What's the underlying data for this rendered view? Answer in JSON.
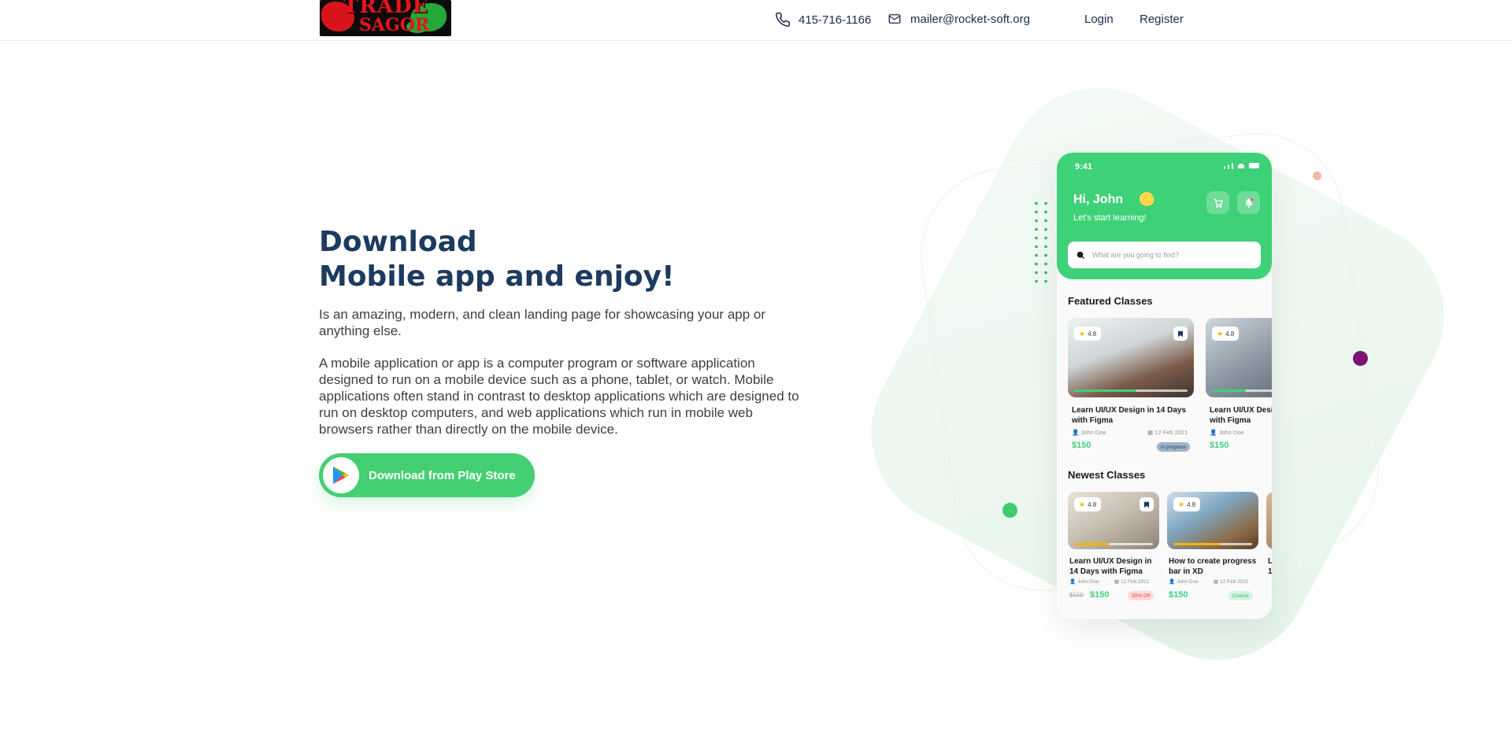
{
  "header": {
    "logo_line1": "TRADE",
    "logo_line2": "SAGOR",
    "phone": "415-716-1166",
    "email": "mailer@rocket-soft.org",
    "login": "Login",
    "register": "Register",
    "icons": {
      "phone": "phone-icon",
      "email": "mail-icon"
    }
  },
  "hero": {
    "title_line1": "Download",
    "title_line2": "Mobile app and enjoy!",
    "lead": "Is an amazing, modern, and clean landing page for showcasing your app or anything else.",
    "body": "A mobile application or app is a computer program or software application designed to run on a mobile device such as a phone, tablet, or watch. Mobile applications often stand in contrast to desktop applications which are designed to run on desktop computers, and web applications which run in mobile web browsers rather than directly on the mobile device.",
    "button_label": "Download from Play Store",
    "button_icon": "google-play-icon"
  },
  "colors": {
    "accent_green": "#44cf72",
    "title_navy": "#1d3a5f",
    "dot_purple": "#7d1473",
    "dot_pink": "#f5b5a8"
  },
  "phone_app": {
    "time": "9:41",
    "greeting": "Hi, John",
    "subtitle": "Let's start learning!",
    "search_placeholder": "What are you going to find?",
    "featured_title": "Featured Classes",
    "newest_title": "Newest Classes",
    "featured": [
      {
        "rating": "4.8",
        "title_l1": "Learn UI/UX Design in 14 Days",
        "title_l2": "with Figma",
        "author": "John Doe",
        "date": "12 Feb 2021",
        "price": "$150",
        "badge": "in progress",
        "progress": 0.55
      },
      {
        "rating": "4.8",
        "title_l1": "Learn UI/UX Desi",
        "title_l2": "with Figma",
        "author": "John Doe",
        "price": "$150",
        "progress": 0.3
      }
    ],
    "newest": [
      {
        "rating": "4.8",
        "title_l1": "Learn UI/UX Design in",
        "title_l2": "14 Days with Figma",
        "author": "John Doe",
        "date": "12 Feb 2021",
        "old_price": "$150",
        "price": "$150",
        "badge": "30% Off",
        "progress": 0.45
      },
      {
        "rating": "4.8",
        "title_l1": "How to create progress",
        "title_l2": "bar in XD",
        "author": "John Doe",
        "date": "12 Feb 2021",
        "price": "$150",
        "badge": "Course",
        "progress": 0.6
      },
      {
        "title_l1": "L",
        "title_l2": "1"
      }
    ]
  }
}
